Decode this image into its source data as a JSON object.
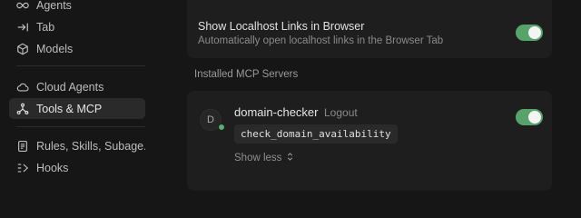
{
  "sidebar": {
    "items": [
      {
        "label": "Agents",
        "icon": "infinity-icon"
      },
      {
        "label": "Tab",
        "icon": "tab-arrow-icon"
      },
      {
        "label": "Models",
        "icon": "cube-icon"
      },
      {
        "label": "Cloud Agents",
        "icon": "cloud-icon"
      },
      {
        "label": "Tools & MCP",
        "icon": "network-icon",
        "active": true
      },
      {
        "label": "Rules, Skills, Subage...",
        "icon": "document-icon"
      },
      {
        "label": "Hooks",
        "icon": "hook-icon"
      }
    ]
  },
  "settings": {
    "localhost": {
      "title": "Show Localhost Links in Browser",
      "description": "Automatically open localhost links in the Browser Tab",
      "enabled": true
    }
  },
  "mcp": {
    "heading": "Installed MCP Servers",
    "server": {
      "avatar_letter": "D",
      "name": "domain-checker",
      "logout_label": "Logout",
      "tool": "check_domain_availability",
      "show_less_label": "Show less",
      "enabled": true,
      "status": "connected"
    }
  },
  "colors": {
    "background": "#161616",
    "card": "#1e1e1e",
    "toggle_on": "#56a46a",
    "status_green": "#56b06e"
  }
}
